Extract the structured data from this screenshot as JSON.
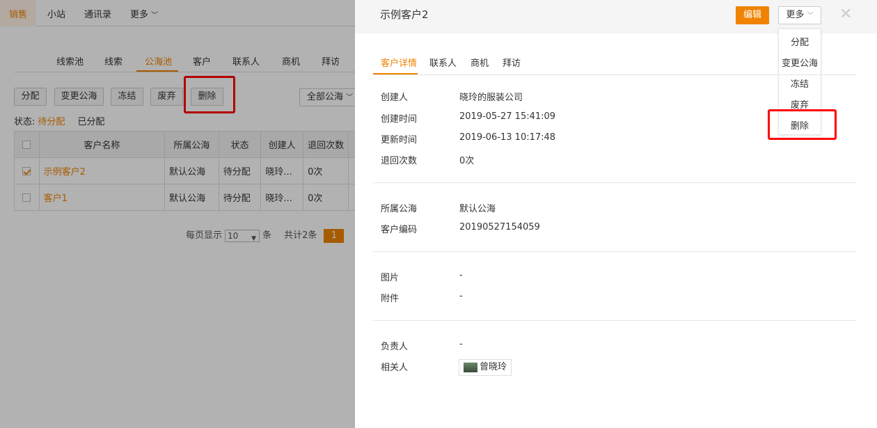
{
  "topnav": {
    "items": [
      "销售",
      "小站",
      "通讯录",
      "更多"
    ]
  },
  "subtabs": [
    "线索池",
    "线索",
    "公海池",
    "客户",
    "联系人",
    "商机",
    "拜访"
  ],
  "toolbar": {
    "buttons": [
      "分配",
      "变更公海",
      "冻结",
      "废弃",
      "删除"
    ],
    "select": "全部公海"
  },
  "status": {
    "label": "状态:",
    "options": [
      "待分配",
      "已分配"
    ]
  },
  "table": {
    "headers": [
      "客户名称",
      "所属公海",
      "状态",
      "创建人",
      "退回次数"
    ],
    "rows": [
      {
        "checked": true,
        "name": "示例客户2",
        "pool": "默认公海",
        "status": "待分配",
        "creator": "晓玲...",
        "returns": "0次"
      },
      {
        "checked": false,
        "name": "客户1",
        "pool": "默认公海",
        "status": "待分配",
        "creator": "晓玲...",
        "returns": "0次"
      }
    ]
  },
  "pager": {
    "prefix": "每页显示",
    "size": "10",
    "suffix": "条",
    "total": "共计2条",
    "page": "1"
  },
  "panel": {
    "title": "示例客户2",
    "edit": "编辑",
    "more": "更多",
    "dropdown": [
      "分配",
      "变更公海",
      "冻结",
      "废弃",
      "删除"
    ],
    "tabs": [
      "客户详情",
      "联系人",
      "商机",
      "拜访"
    ],
    "fields": {
      "creator": {
        "label": "创建人",
        "value": "晓玲的服装公司"
      },
      "created": {
        "label": "创建时间",
        "value": "2019-05-27 15:41:09"
      },
      "updated": {
        "label": "更新时间",
        "value": "2019-06-13 10:17:48"
      },
      "returns": {
        "label": "退回次数",
        "value": "0次"
      },
      "pool": {
        "label": "所属公海",
        "value": "默认公海"
      },
      "code": {
        "label": "客户编码",
        "value": "20190527154059"
      },
      "image": {
        "label": "图片",
        "value": "-"
      },
      "attach": {
        "label": "附件",
        "value": "-"
      },
      "owner": {
        "label": "负责人",
        "value": "-"
      },
      "related": {
        "label": "相关人",
        "value": "曾晓玲"
      }
    }
  },
  "colors": {
    "accent": "#f08300",
    "highlight": "#ff0000"
  }
}
